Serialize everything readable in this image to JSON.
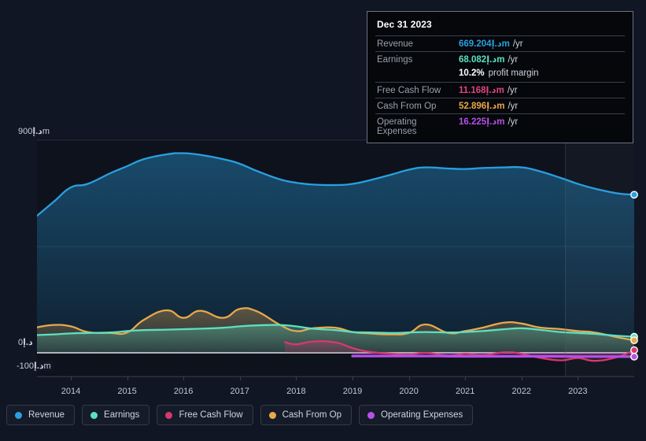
{
  "currency_symbol": "د.إ",
  "tooltip": {
    "date": "Dec 31 2023",
    "rows": [
      {
        "label": "Revenue",
        "value": "669.204",
        "unit": "m",
        "per": "/yr",
        "color": "#2a9fe0"
      },
      {
        "label": "Earnings",
        "value": "68.082",
        "unit": "m",
        "per": "/yr",
        "color": "#5ce0c0"
      },
      {
        "label": "",
        "value": "10.2%",
        "sub": "profit margin",
        "color": "#ffffff"
      },
      {
        "label": "Free Cash Flow",
        "value": "11.168",
        "unit": "m",
        "per": "/yr",
        "color": "#e0457c"
      },
      {
        "label": "Cash From Op",
        "value": "52.896",
        "unit": "m",
        "per": "/yr",
        "color": "#e8a84c"
      },
      {
        "label": "Operating Expenses",
        "value": "16.225",
        "unit": "m",
        "per": "/yr",
        "color": "#b750e8"
      }
    ]
  },
  "axes": {
    "y_labels": [
      {
        "text": "900",
        "unit": "m",
        "value": 900
      },
      {
        "text": "0",
        "unit": "",
        "value": 0
      },
      {
        "text": "-100",
        "unit": "m",
        "value": -100
      }
    ],
    "x_labels": [
      "2014",
      "2015",
      "2016",
      "2017",
      "2018",
      "2019",
      "2020",
      "2021",
      "2022",
      "2023"
    ]
  },
  "legend": [
    {
      "label": "Revenue",
      "color": "#2a9fe0"
    },
    {
      "label": "Earnings",
      "color": "#5ce0c0"
    },
    {
      "label": "Free Cash Flow",
      "color": "#d6396e"
    },
    {
      "label": "Cash From Op",
      "color": "#e8a84c"
    },
    {
      "label": "Operating Expenses",
      "color": "#b750e8"
    }
  ],
  "chart_data": {
    "type": "area",
    "title": "",
    "xlabel": "",
    "ylabel": "د.إ",
    "ylim": [
      -100,
      900
    ],
    "grid": true,
    "legend_position": "bottom",
    "x_range": [
      "2013-06",
      "2023-12"
    ],
    "highlight_band": {
      "from": "2022-10",
      "to": "2023-12"
    },
    "series": [
      {
        "name": "Revenue",
        "color": "#2a9fe0",
        "fill": "rgba(33,120,180,0.30)",
        "x": [
          2013.4,
          2013.7,
          2014.0,
          2014.3,
          2014.7,
          2015.0,
          2015.3,
          2015.7,
          2016.0,
          2016.3,
          2016.7,
          2017.0,
          2017.3,
          2017.7,
          2018.0,
          2018.3,
          2018.7,
          2019.0,
          2019.3,
          2019.7,
          2020.0,
          2020.3,
          2020.7,
          2021.0,
          2021.3,
          2021.7,
          2022.0,
          2022.3,
          2022.7,
          2023.0,
          2023.3,
          2023.7,
          2024.0
        ],
        "values": [
          580,
          640,
          700,
          715,
          760,
          790,
          820,
          840,
          845,
          838,
          820,
          800,
          770,
          735,
          720,
          712,
          710,
          715,
          730,
          755,
          775,
          785,
          780,
          778,
          782,
          785,
          785,
          770,
          740,
          715,
          695,
          675,
          669.204
        ]
      },
      {
        "name": "Earnings",
        "color": "#5ce0c0",
        "fill": "rgba(92,224,192,0.22)",
        "x": [
          2013.4,
          2013.7,
          2014.0,
          2014.3,
          2014.7,
          2015.0,
          2015.3,
          2015.7,
          2016.0,
          2016.3,
          2016.7,
          2017.0,
          2017.3,
          2017.7,
          2018.0,
          2018.3,
          2018.7,
          2019.0,
          2019.3,
          2019.7,
          2020.0,
          2020.3,
          2020.7,
          2021.0,
          2021.3,
          2021.7,
          2022.0,
          2022.3,
          2022.7,
          2023.0,
          2023.3,
          2023.7,
          2024.0
        ],
        "values": [
          75,
          78,
          82,
          84,
          86,
          92,
          96,
          98,
          100,
          102,
          106,
          112,
          116,
          118,
          112,
          102,
          96,
          88,
          86,
          84,
          86,
          88,
          86,
          88,
          92,
          100,
          104,
          98,
          88,
          84,
          80,
          72,
          68.082
        ]
      },
      {
        "name": "Free Cash Flow",
        "color": "#d6396e",
        "fill": "rgba(214,57,110,0.20)",
        "x": [
          2017.8,
          2018.0,
          2018.3,
          2018.7,
          2019.0,
          2019.3,
          2019.7,
          2020.0,
          2020.3,
          2020.7,
          2021.0,
          2021.3,
          2021.7,
          2022.0,
          2022.3,
          2022.7,
          2023.0,
          2023.3,
          2023.7,
          2024.0
        ],
        "values": [
          45,
          36,
          48,
          44,
          20,
          4,
          -4,
          -8,
          0,
          -12,
          -4,
          -10,
          2,
          -4,
          -20,
          -32,
          -22,
          -34,
          -18,
          11.168
        ]
      },
      {
        "name": "Cash From Op",
        "color": "#e8a84c",
        "fill": "rgba(232,168,76,0.18)",
        "x": [
          2013.4,
          2013.7,
          2014.0,
          2014.3,
          2014.7,
          2015.0,
          2015.3,
          2015.7,
          2016.0,
          2016.3,
          2016.7,
          2017.0,
          2017.3,
          2017.7,
          2018.0,
          2018.3,
          2018.7,
          2019.0,
          2019.3,
          2019.7,
          2020.0,
          2020.3,
          2020.7,
          2021.0,
          2021.3,
          2021.7,
          2022.0,
          2022.3,
          2022.7,
          2023.0,
          2023.3,
          2023.7,
          2024.0
        ],
        "values": [
          108,
          118,
          112,
          88,
          84,
          86,
          140,
          180,
          148,
          178,
          148,
          186,
          176,
          120,
          92,
          104,
          106,
          88,
          82,
          78,
          84,
          120,
          84,
          92,
          106,
          128,
          124,
          108,
          100,
          92,
          86,
          66,
          52.896
        ]
      },
      {
        "name": "Operating Expenses",
        "color": "#b750e8",
        "fill": "rgba(183,80,232,0.14)",
        "x": [
          2019.0,
          2019.5,
          2020.0,
          2020.5,
          2021.0,
          2021.5,
          2022.0,
          2022.5,
          2023.0,
          2023.5,
          2024.0
        ],
        "values": [
          -14,
          -14,
          -14,
          -14,
          -15,
          -15,
          -15,
          -15,
          -16,
          -16,
          -16.225
        ]
      }
    ]
  }
}
